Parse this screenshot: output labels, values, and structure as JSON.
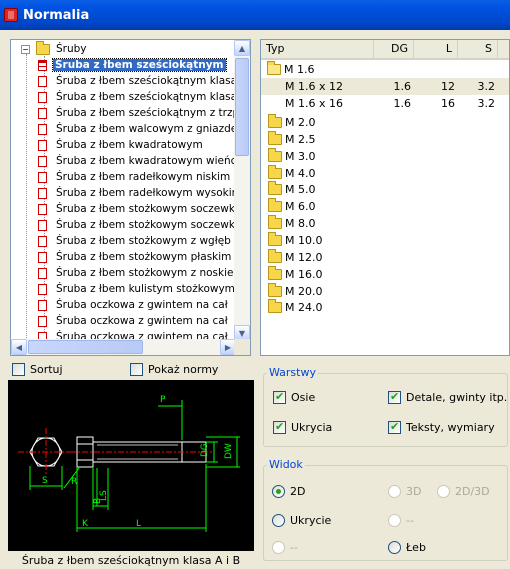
{
  "window": {
    "title": "Normalia"
  },
  "tree": {
    "root_label": "Śruby",
    "root_expander": "−",
    "selected_label": "Śruba z łbem sześciokątnym",
    "items": [
      "Śruba z łbem sześciokątnym klasa",
      "Śruba z łbem sześciokątnym klasa",
      "Śruba z łbem sześciokątnym z trzp",
      "Śruba z łbem walcowym z gniazdem",
      "Śruba z łbem kwadratowym",
      "Śruba z łbem kwadratowym wieńc",
      "Śruba z łbem radełkowym niskim",
      "Śruba z łbem radełkowym wysokim",
      "Śruba z łbem stożkowym soczewk",
      "Śruba z łbem stożkowym soczewk",
      "Śruba z łbem stożkowym z wgłęb",
      "Śruba z łbem stożkowym płaskim",
      "Śruba z łbem stożkowym z noskie",
      "Śruba z łbem kulistym stożkowym",
      "Śruba oczkowa z gwintem na cał",
      "Śruba oczkowa z gwintem na cał",
      "Śruba oczkowa z gwintem na cał"
    ]
  },
  "table": {
    "headers": {
      "type": "Typ",
      "dg": "DG",
      "l": "L",
      "s": "S"
    },
    "open_group": "M 1.6",
    "rows": [
      {
        "type": "M 1.6 x 12",
        "dg": "1.6",
        "l": "12",
        "s": "3.2"
      },
      {
        "type": "M 1.6 x 16",
        "dg": "1.6",
        "l": "16",
        "s": "3.2"
      }
    ],
    "groups": [
      "M 2.0",
      "M 2.5",
      "M 3.0",
      "M 4.0",
      "M 5.0",
      "M 6.0",
      "M 8.0",
      "M 10.0",
      "M 12.0",
      "M 16.0",
      "M 20.0",
      "M 24.0"
    ]
  },
  "options": {
    "sort_label": "Sortuj",
    "sort_checked": false,
    "show_norms_label": "Pokaż normy",
    "show_norms_checked": false
  },
  "layers": {
    "label": "Warstwy",
    "axes": {
      "label": "Osie",
      "checked": true
    },
    "details": {
      "label": "Detale, gwinty itp.",
      "checked": true
    },
    "hidden": {
      "label": "Ukrycia",
      "checked": true
    },
    "texts": {
      "label": "Teksty, wymiary",
      "checked": true
    }
  },
  "view": {
    "label": "Widok",
    "v2d": "2D",
    "v3d": "3D",
    "v2d3d": "2D/3D",
    "hidden": "Ukrycie",
    "dash1": "--",
    "dash2": "--",
    "arc": "Łeb",
    "selected": "2D"
  },
  "drawing": {
    "labels": {
      "p": "P",
      "dg": "DG",
      "dw": "DW",
      "s": "S",
      "r": "R",
      "ls": "LS",
      "b": "B",
      "k": "K",
      "l": "L"
    }
  },
  "caption": "Śruba z łbem sześciokątnym klasa A i B",
  "colors": {
    "title_bar": "#0054e3",
    "drawing_bg": "#000000",
    "dimension_green": "#00ff00",
    "outline_white": "#ffffff",
    "selection": "#316ac5"
  }
}
